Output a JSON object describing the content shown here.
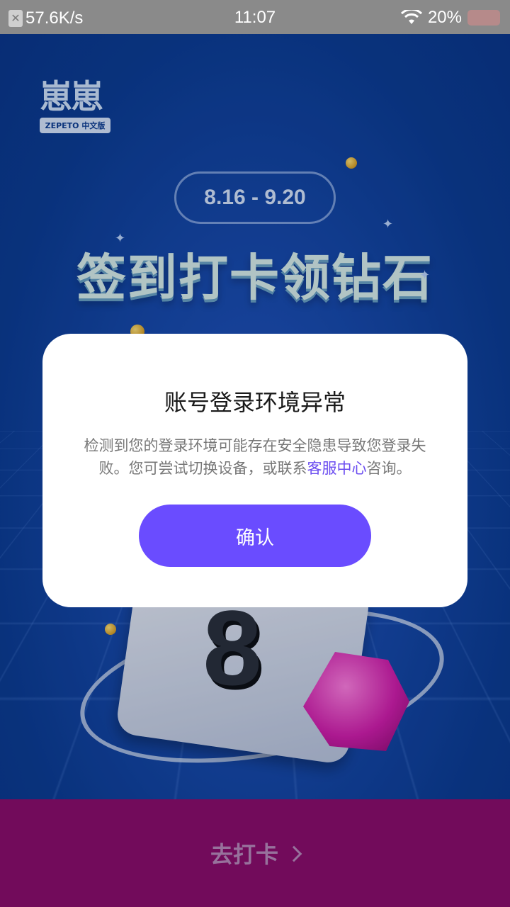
{
  "status_bar": {
    "network_speed": "57.6K/s",
    "time": "11:07",
    "battery_percent": "20%"
  },
  "background": {
    "logo_text": "崽崽",
    "logo_subtext": "ZEPETO 中文版",
    "date_range": "8.16 - 9.20",
    "headline": "签到打卡领钻石",
    "calendar_digit": "8"
  },
  "dialog": {
    "title": "账号登录环境异常",
    "message_part1": "检测到您的登录环境可能存在安全隐患导致您登录失败。您可尝试切换设备，或联系",
    "message_link": "客服中心",
    "message_part2": "咨询。",
    "confirm_label": "确认"
  },
  "bottom_bar": {
    "label": "去打卡"
  },
  "colors": {
    "accent": "#6a4cff",
    "link": "#6b4df0",
    "background": "#0b3d97",
    "bottom_bar": "#8b0e6f"
  }
}
